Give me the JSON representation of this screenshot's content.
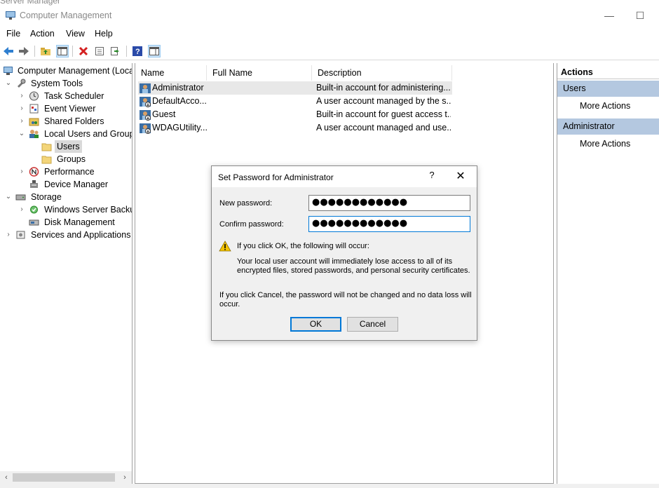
{
  "background_title": "Server Manager",
  "window": {
    "title": "Computer Management",
    "minimize": "—",
    "maximize": "☐"
  },
  "menu": [
    "File",
    "Action",
    "View",
    "Help"
  ],
  "toolbar_icons": [
    "back-arrow-icon",
    "forward-arrow-icon",
    "up-folder-icon",
    "show-hide-tree-icon",
    "delete-icon",
    "properties-icon",
    "export-list-icon",
    "help-icon",
    "show-hide-action-pane-icon"
  ],
  "tree": {
    "root": "Computer Management (Local)",
    "system_tools": "System Tools",
    "task_scheduler": "Task Scheduler",
    "event_viewer": "Event Viewer",
    "shared_folders": "Shared Folders",
    "local_users": "Local Users and Groups",
    "users": "Users",
    "groups": "Groups",
    "performance": "Performance",
    "device_manager": "Device Manager",
    "storage": "Storage",
    "wsb": "Windows Server Backup",
    "disk_mgmt": "Disk Management",
    "services": "Services and Applications"
  },
  "list": {
    "columns": {
      "name": "Name",
      "full_name": "Full Name",
      "description": "Description"
    },
    "rows": [
      {
        "name": "Administrator",
        "full_name": "",
        "description": "Built-in account for administering..."
      },
      {
        "name": "DefaultAcco...",
        "full_name": "",
        "description": "A user account managed by the s..."
      },
      {
        "name": "Guest",
        "full_name": "",
        "description": "Built-in account for guest access t..."
      },
      {
        "name": "WDAGUtility...",
        "full_name": "",
        "description": "A user account managed and use..."
      }
    ]
  },
  "actions": {
    "header": "Actions",
    "section1": "Users",
    "more1": "More Actions",
    "section2": "Administrator",
    "more2": "More Actions"
  },
  "dialog": {
    "title": "Set Password for Administrator",
    "help": "?",
    "close": "✕",
    "new_password_label": "New password:",
    "new_password_value": "●●●●●●●●●●●●",
    "confirm_password_label": "Confirm password:",
    "confirm_password_value": "●●●●●●●●●●●●",
    "warning_heading": "If you click OK, the following will occur:",
    "warning_line1": "Your local user account will immediately lose access to all of its",
    "warning_line2": "encrypted files, stored passwords, and personal security certificates.",
    "cancel_line1": "If you click Cancel, the password will not be changed and no data loss will",
    "cancel_line2": "occur.",
    "ok": "OK",
    "cancel": "Cancel"
  }
}
